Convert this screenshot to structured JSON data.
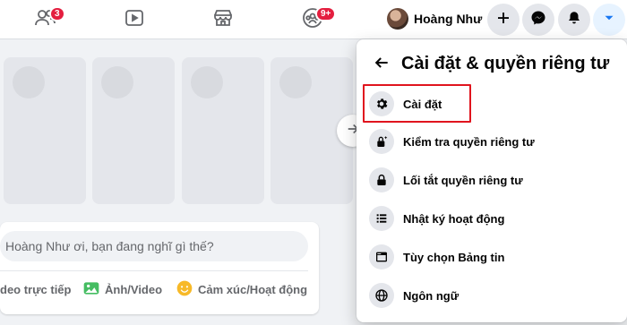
{
  "navbar": {
    "friends_badge": "3",
    "groups_badge": "9+",
    "profile_name": "Hoàng Như"
  },
  "composer": {
    "placeholder": "Hoàng Như ơi, bạn đang nghĩ gì thế?",
    "actions": [
      {
        "label": "deo trực tiếp",
        "icon": "live-video-icon"
      },
      {
        "label": "Ảnh/Video",
        "icon": "photo-icon"
      },
      {
        "label": "Cảm xúc/Hoạt động",
        "icon": "feeling-icon"
      }
    ]
  },
  "menu": {
    "title": "Cài đặt & quyền riêng tư",
    "items": [
      {
        "label": "Cài đặt",
        "icon": "gear-icon"
      },
      {
        "label": "Kiểm tra quyền riêng tư",
        "icon": "privacy-checkup-icon"
      },
      {
        "label": "Lối tắt quyền riêng tư",
        "icon": "lock-icon"
      },
      {
        "label": "Nhật ký hoạt động",
        "icon": "activity-log-icon"
      },
      {
        "label": "Tùy chọn Bảng tin",
        "icon": "news-feed-icon"
      },
      {
        "label": "Ngôn ngữ",
        "icon": "globe-icon"
      }
    ]
  },
  "colors": {
    "accent": "#1877f2",
    "badge": "#e41e3f",
    "highlight_border": "#e0141e"
  }
}
